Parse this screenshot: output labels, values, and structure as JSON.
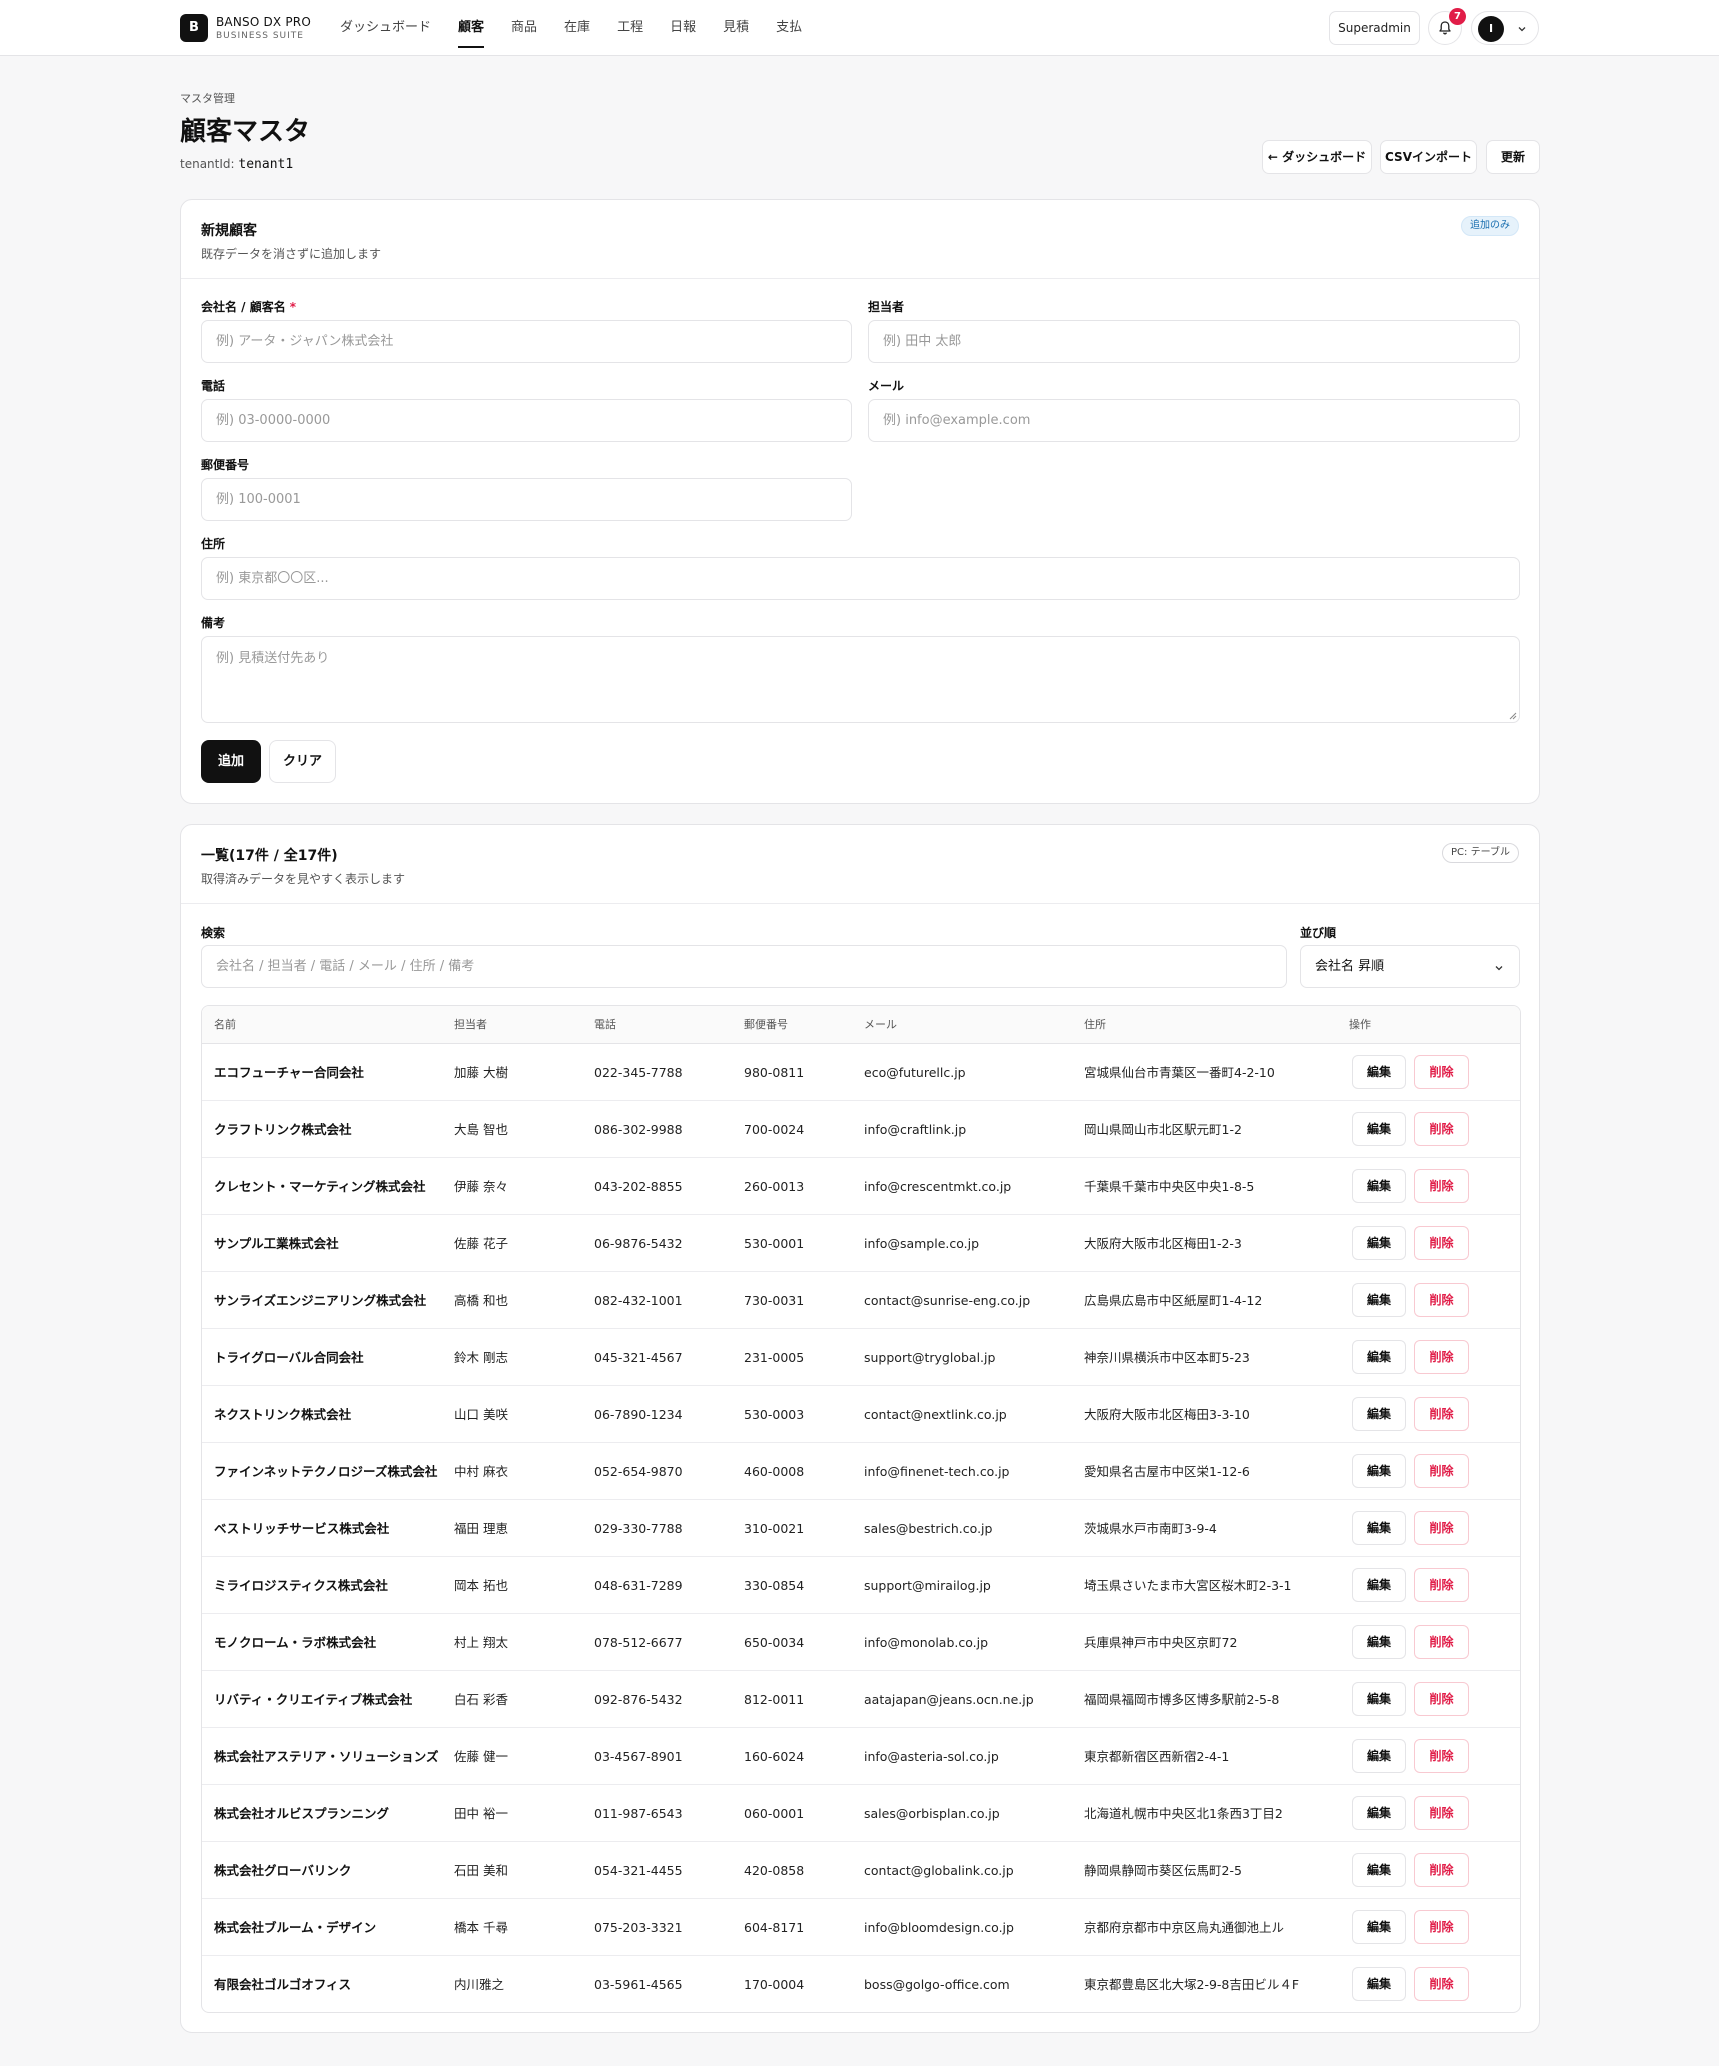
{
  "header": {
    "logo_letter": "B",
    "brand": "BANSO DX PRO",
    "brand_sub": "BUSINESS SUITE",
    "nav": [
      {
        "label": "ダッシュボード",
        "active": false
      },
      {
        "label": "顧客",
        "active": true
      },
      {
        "label": "商品",
        "active": false
      },
      {
        "label": "在庫",
        "active": false
      },
      {
        "label": "工程",
        "active": false
      },
      {
        "label": "日報",
        "active": false
      },
      {
        "label": "見積",
        "active": false
      },
      {
        "label": "支払",
        "active": false
      }
    ],
    "role": "Superadmin",
    "notification_count": "7",
    "avatar_letter": "I"
  },
  "page": {
    "breadcrumb": "マスタ管理",
    "title": "顧客マスタ",
    "tenant_label": "tenantId:",
    "tenant_value": "tenant1",
    "back_button": "← ダッシュボード",
    "csv_button": "CSVインポート",
    "refresh_button": "更新"
  },
  "form": {
    "title": "新規顧客",
    "description": "既存データを消さずに追加します",
    "badge": "追加のみ",
    "fields": {
      "company": {
        "label": "会社名 / 顧客名",
        "required_mark": "*",
        "placeholder": "例) アータ・ジャパン株式会社"
      },
      "contact": {
        "label": "担当者",
        "placeholder": "例) 田中 太郎"
      },
      "phone": {
        "label": "電話",
        "placeholder": "例) 03-0000-0000"
      },
      "email": {
        "label": "メール",
        "placeholder": "例) info@example.com"
      },
      "postal": {
        "label": "郵便番号",
        "placeholder": "例) 100-0001"
      },
      "address": {
        "label": "住所",
        "placeholder": "例) 東京都〇〇区..."
      },
      "note": {
        "label": "備考",
        "placeholder": "例) 見積送付先あり"
      }
    },
    "add_button": "追加",
    "clear_button": "クリア"
  },
  "list": {
    "title": "一覧(17件 / 全17件)",
    "description": "取得済みデータを見やすく表示します",
    "badge": "PC: テーブル",
    "search_label": "検索",
    "search_placeholder": "会社名 / 担当者 / 電話 / メール / 住所 / 備考",
    "sort_label": "並び順",
    "sort_value": "会社名 昇順",
    "columns": {
      "name": "名前",
      "contact": "担当者",
      "phone": "電話",
      "postal": "郵便番号",
      "email": "メール",
      "address": "住所",
      "actions": "操作"
    },
    "edit_label": "編集",
    "delete_label": "削除",
    "rows": [
      {
        "name": "エコフューチャー合同会社",
        "contact": "加藤 大樹",
        "phone": "022-345-7788",
        "postal": "980-0811",
        "email": "eco@futurellc.jp",
        "address": "宮城県仙台市青葉区一番町4-2-10"
      },
      {
        "name": "クラフトリンク株式会社",
        "contact": "大島 智也",
        "phone": "086-302-9988",
        "postal": "700-0024",
        "email": "info@craftlink.jp",
        "address": "岡山県岡山市北区駅元町1-2"
      },
      {
        "name": "クレセント・マーケティング株式会社",
        "contact": "伊藤 奈々",
        "phone": "043-202-8855",
        "postal": "260-0013",
        "email": "info@crescentmkt.co.jp",
        "address": "千葉県千葉市中央区中央1-8-5"
      },
      {
        "name": "サンプル工業株式会社",
        "contact": "佐藤 花子",
        "phone": "06-9876-5432",
        "postal": "530-0001",
        "email": "info@sample.co.jp",
        "address": "大阪府大阪市北区梅田1-2-3"
      },
      {
        "name": "サンライズエンジニアリング株式会社",
        "contact": "高橋 和也",
        "phone": "082-432-1001",
        "postal": "730-0031",
        "email": "contact@sunrise-eng.co.jp",
        "address": "広島県広島市中区紙屋町1-4-12"
      },
      {
        "name": "トライグローバル合同会社",
        "contact": "鈴木 剛志",
        "phone": "045-321-4567",
        "postal": "231-0005",
        "email": "support@tryglobal.jp",
        "address": "神奈川県横浜市中区本町5-23"
      },
      {
        "name": "ネクストリンク株式会社",
        "contact": "山口 美咲",
        "phone": "06-7890-1234",
        "postal": "530-0003",
        "email": "contact@nextlink.co.jp",
        "address": "大阪府大阪市北区梅田3-3-10"
      },
      {
        "name": "ファインネットテクノロジーズ株式会社",
        "contact": "中村 麻衣",
        "phone": "052-654-9870",
        "postal": "460-0008",
        "email": "info@finenet-tech.co.jp",
        "address": "愛知県名古屋市中区栄1-12-6"
      },
      {
        "name": "ベストリッチサービス株式会社",
        "contact": "福田 理恵",
        "phone": "029-330-7788",
        "postal": "310-0021",
        "email": "sales@bestrich.co.jp",
        "address": "茨城県水戸市南町3-9-4"
      },
      {
        "name": "ミライロジスティクス株式会社",
        "contact": "岡本 拓也",
        "phone": "048-631-7289",
        "postal": "330-0854",
        "email": "support@mirailog.jp",
        "address": "埼玉県さいたま市大宮区桜木町2-3-1"
      },
      {
        "name": "モノクローム・ラボ株式会社",
        "contact": "村上 翔太",
        "phone": "078-512-6677",
        "postal": "650-0034",
        "email": "info@monolab.co.jp",
        "address": "兵庫県神戸市中央区京町72"
      },
      {
        "name": "リバティ・クリエイティブ株式会社",
        "contact": "白石 彩香",
        "phone": "092-876-5432",
        "postal": "812-0011",
        "email": "aatajapan@jeans.ocn.ne.jp",
        "address": "福岡県福岡市博多区博多駅前2-5-8"
      },
      {
        "name": "株式会社アステリア・ソリューションズ",
        "contact": "佐藤 健一",
        "phone": "03-4567-8901",
        "postal": "160-6024",
        "email": "info@asteria-sol.co.jp",
        "address": "東京都新宿区西新宿2-4-1"
      },
      {
        "name": "株式会社オルビスプランニング",
        "contact": "田中 裕一",
        "phone": "011-987-6543",
        "postal": "060-0001",
        "email": "sales@orbisplan.co.jp",
        "address": "北海道札幌市中央区北1条西3丁目2"
      },
      {
        "name": "株式会社グローバリンク",
        "contact": "石田 美和",
        "phone": "054-321-4455",
        "postal": "420-0858",
        "email": "contact@globalink.co.jp",
        "address": "静岡県静岡市葵区伝馬町2-5"
      },
      {
        "name": "株式会社ブルーム・デザイン",
        "contact": "橋本 千尋",
        "phone": "075-203-3321",
        "postal": "604-8171",
        "email": "info@bloomdesign.co.jp",
        "address": "京都府京都市中京区烏丸通御池上ル"
      },
      {
        "name": "有限会社ゴルゴオフィス",
        "contact": "内川雅之",
        "phone": "03-5961-4565",
        "postal": "170-0004",
        "email": "boss@golgo-office.com",
        "address": "東京都豊島区北大塚2-9-8吉田ビル４F"
      }
    ]
  }
}
